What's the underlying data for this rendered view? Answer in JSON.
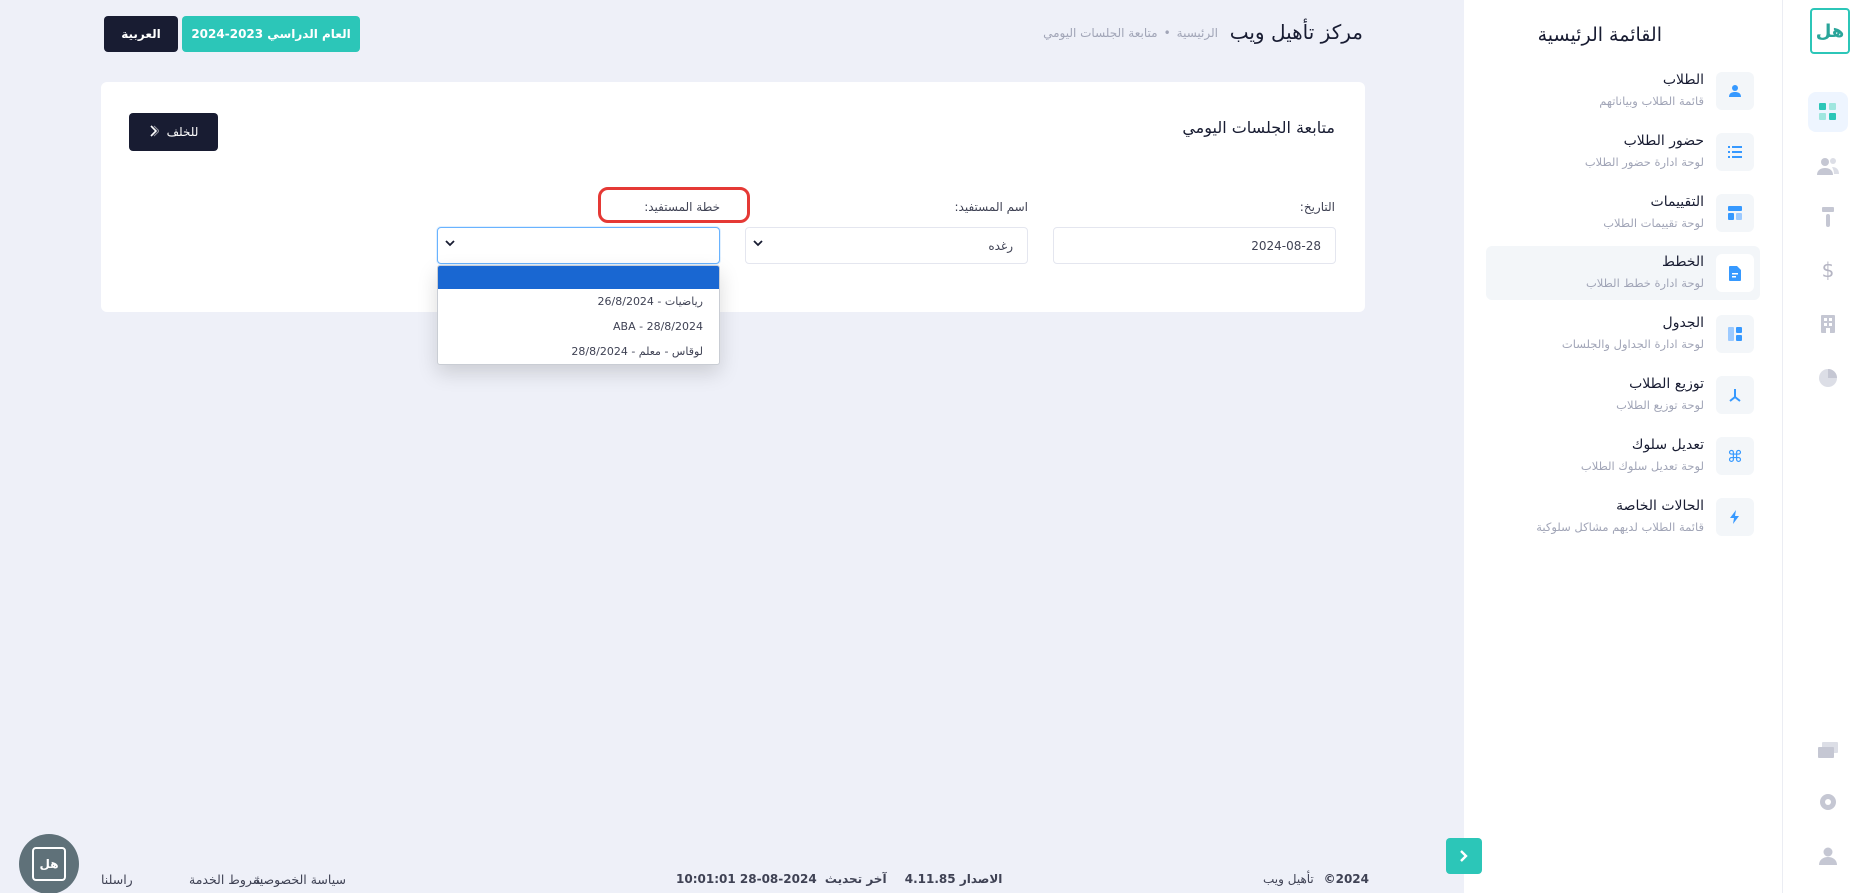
{
  "header": {
    "title": "مركز تأهيل ويب",
    "breadcrumb": [
      "الرئيسية",
      "متابعة الجلسات اليومي"
    ],
    "year_button": "العام الدراسي 2023-2024",
    "lang_button": "العربية"
  },
  "sidebar": {
    "title": "القائمة الرئيسية",
    "items": [
      {
        "label": "الطلاب",
        "sub": "قائمة الطلاب وبياناتهم",
        "icon": "student-icon"
      },
      {
        "label": "حضور الطلاب",
        "sub": "لوحة ادارة حضور الطلاب",
        "icon": "list-icon"
      },
      {
        "label": "التقييمات",
        "sub": "لوحة تقييمات الطلاب",
        "icon": "layout-icon"
      },
      {
        "label": "الخطط",
        "sub": "لوحة ادارة خطط الطلاب",
        "icon": "document-icon",
        "active": true
      },
      {
        "label": "الجدول",
        "sub": "لوحة ادارة الجداول والجلسات",
        "icon": "table-icon"
      },
      {
        "label": "توزيع الطلاب",
        "sub": "لوحة توزيع الطلاب",
        "icon": "distribution-icon"
      },
      {
        "label": "تعديل سلوك",
        "sub": "لوحة تعديل سلوك الطلاب",
        "icon": "command-icon"
      },
      {
        "label": "الحالات الخاصة",
        "sub": "قائمة الطلاب لديهم مشاكل سلوكية",
        "icon": "bolt-icon"
      }
    ]
  },
  "rail": {
    "logo_text": "هل",
    "icons": [
      "dashboard-icon",
      "users-icon",
      "brush-icon",
      "dollar-icon",
      "building-icon",
      "chart-icon"
    ],
    "bottom_icons": [
      "cards-icon",
      "settings-icon",
      "user-icon"
    ]
  },
  "card": {
    "title": "متابعة الجلسات اليومي",
    "back_button": "للخلف",
    "date_label": "التاريخ:",
    "date_value": "2024-08-28",
    "name_label": "اسم المستفيد:",
    "name_value": "رغده",
    "plan_label": "خطة المستفيد:",
    "plan_value": ""
  },
  "dropdown": {
    "options": [
      "",
      "رياضيات - 26/8/2024",
      "ABA - 28/8/2024",
      "لوقاس - معلم - 28/8/2024"
    ],
    "selected_index": 0
  },
  "footer": {
    "copyright_year": "2024©",
    "brand": "تأهيل ويب",
    "version_label": "الاصدار",
    "version": "4.11.85",
    "last_update_label": "آخر تحديث",
    "last_update": "2024-08-28 10:01:01",
    "links": [
      "سياسة الخصوصية",
      "شروط الخدمة",
      "راسلنا"
    ]
  },
  "colors": {
    "accent": "#2cc6b8",
    "dark": "#181c32",
    "selected": "#1967d2",
    "highlight": "#e53935"
  }
}
